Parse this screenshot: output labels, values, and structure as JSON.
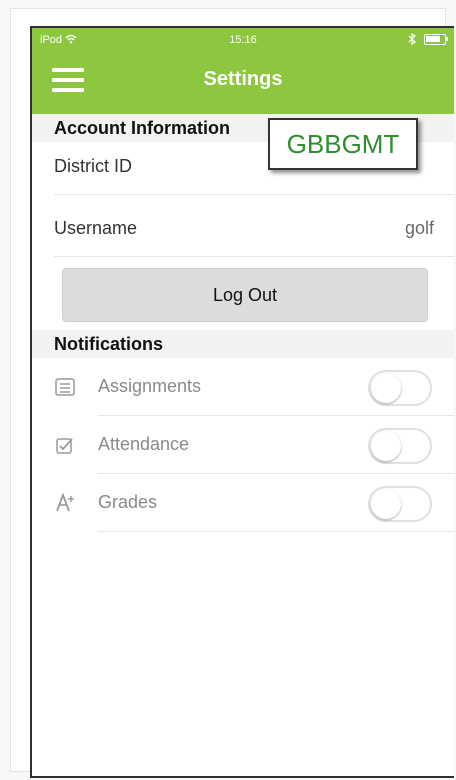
{
  "status_bar": {
    "carrier": "iPod",
    "time": "15:16"
  },
  "header": {
    "title": "Settings"
  },
  "account": {
    "section_title": "Account Information",
    "district_label": "District ID",
    "district_value": "GBBGMT",
    "username_label": "Username",
    "username_value": "golf",
    "logout_label": "Log Out"
  },
  "notifications": {
    "section_title": "Notifications",
    "items": [
      {
        "label": "Assignments",
        "icon": "list-icon",
        "enabled": false
      },
      {
        "label": "Attendance",
        "icon": "checkbox-icon",
        "enabled": false
      },
      {
        "label": "Grades",
        "icon": "grades-icon",
        "enabled": false
      }
    ]
  },
  "colors": {
    "header_green": "#8dc63f",
    "district_text": "#2f8f2f"
  },
  "icons": {
    "menu": "hamburger-icon",
    "wifi": "wifi-icon",
    "bluetooth": "bluetooth-icon",
    "battery": "battery-icon"
  }
}
